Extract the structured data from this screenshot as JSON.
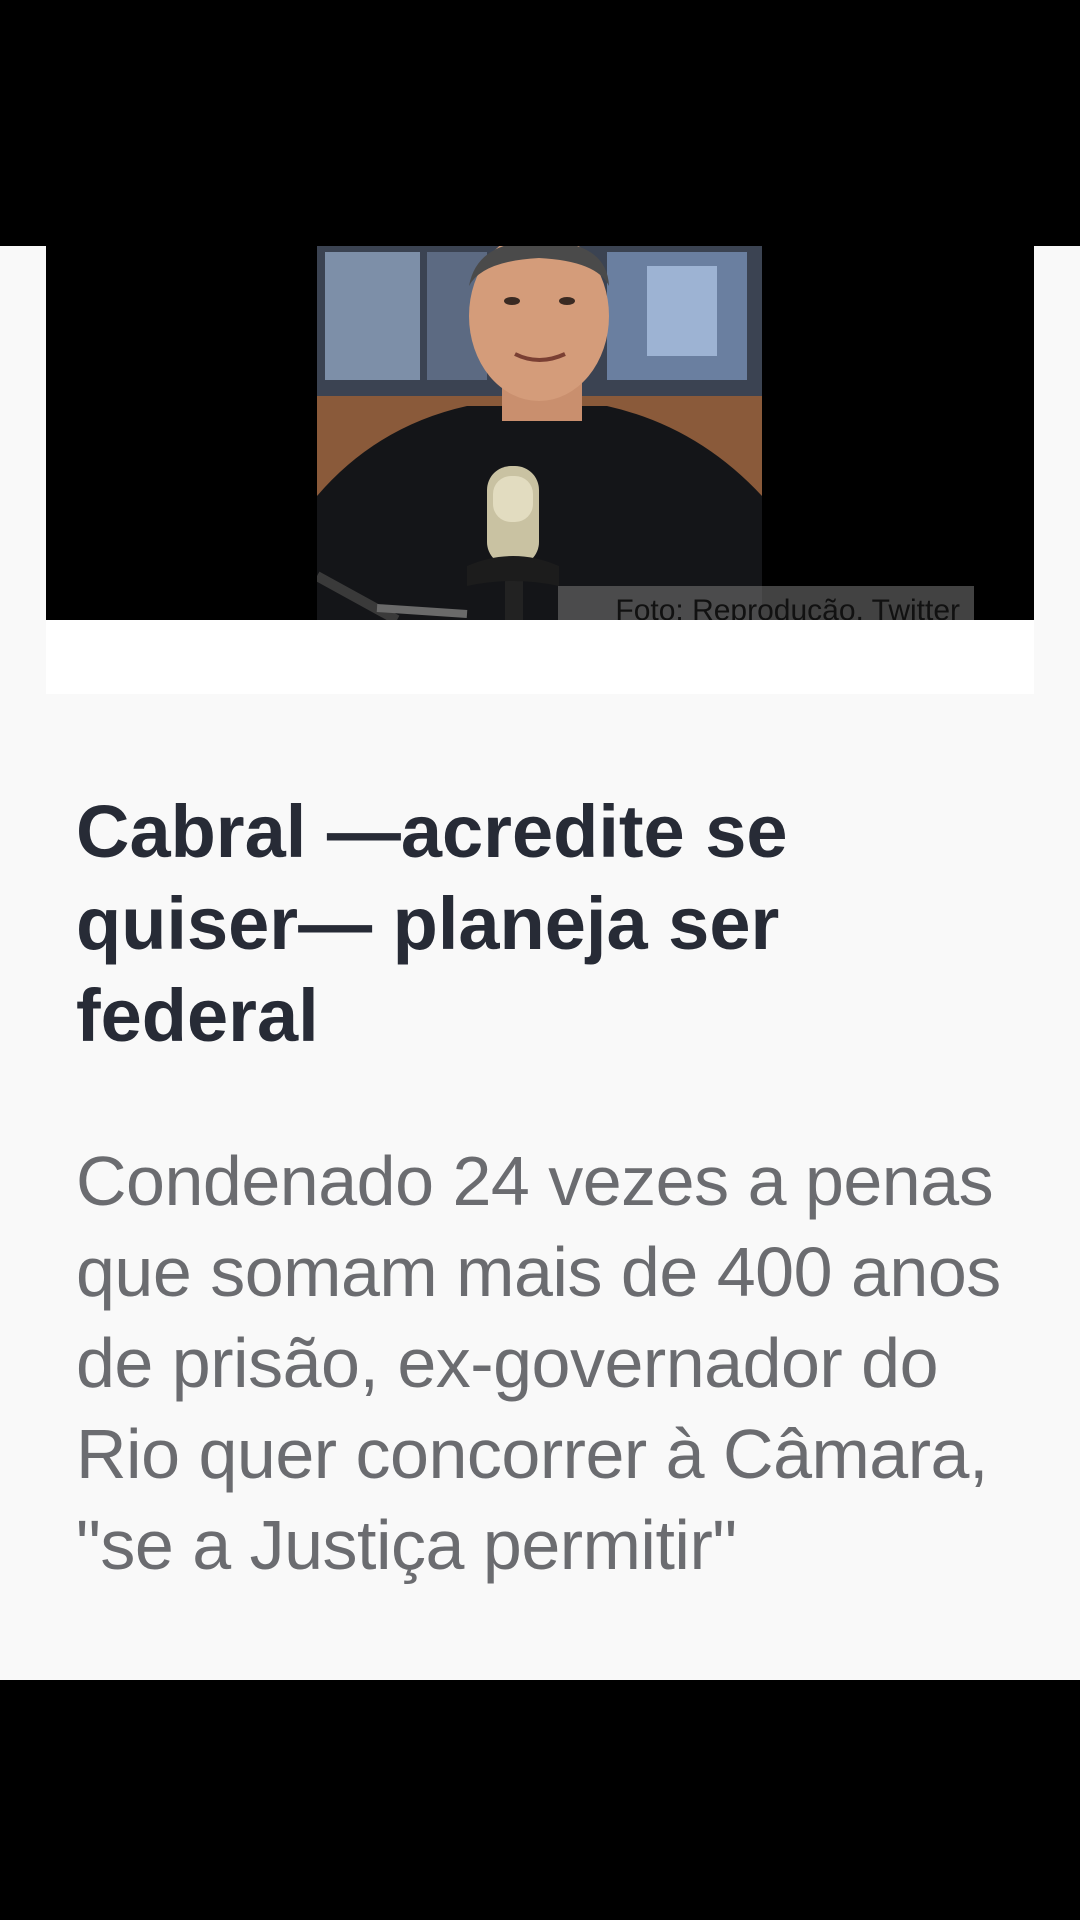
{
  "article": {
    "photo_alt": "Sérgio Cabral em frente a um microfone",
    "photo_caption": "Foto: Reprodução, Twitter",
    "headline": "Cabral —acredite se quiser— planeja ser federal",
    "subtitle": "Condenado 24 vezes a penas que somam mais de 400 anos de prisão, ex-governador do Rio quer concorrer à Câmara, \"se a Justiça permitir\""
  },
  "colors": {
    "headline": "#272b36",
    "subtitle": "#6b6c70",
    "background": "#f9f9f9"
  }
}
